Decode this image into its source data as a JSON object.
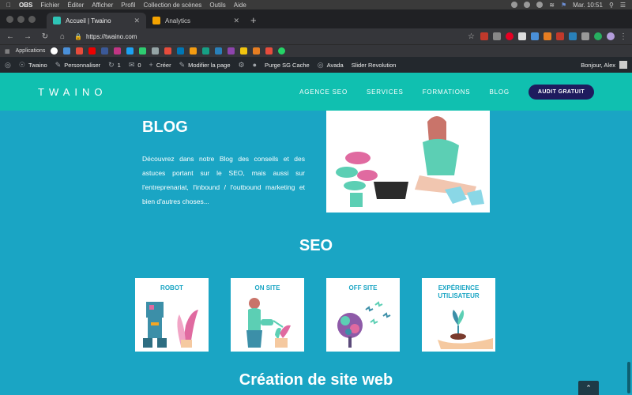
{
  "menubar": {
    "app": "OBS",
    "items": [
      "Fichier",
      "Éditer",
      "Afficher",
      "Profil",
      "Collection de scènes",
      "Outils",
      "Aide"
    ],
    "clock": "Mar. 10:51"
  },
  "tabs": [
    {
      "title": "Accueil | Twaino",
      "color": "#2ec4b6"
    },
    {
      "title": "Analytics",
      "color": "#f4a300"
    }
  ],
  "address": {
    "url": "https://twaino.com"
  },
  "bookmarks": {
    "apps_label": "Applications"
  },
  "wpbar": {
    "site": "Twaino",
    "customize": "Personnaliser",
    "updates": "1",
    "comments": "0",
    "new": "Créer",
    "edit": "Modifier la page",
    "purge": "Purge SG Cache",
    "avada": "Avada",
    "slider": "Slider Revolution",
    "greeting": "Bonjour, Alex"
  },
  "site": {
    "logo": "TWAINO",
    "nav": [
      "AGENCE SEO",
      "SERVICES",
      "FORMATIONS",
      "BLOG"
    ],
    "cta": "AUDIT GRATUIT"
  },
  "blog": {
    "title": "BLOG",
    "text": "Découvrez dans notre Blog des conseils et des astuces portant sur le SEO, mais aussi sur l'entreprenariat, l'inbound / l'outbound marketing et bien d'autres choses..."
  },
  "seo": {
    "title": "SEO",
    "cards": [
      {
        "label": "ROBOT"
      },
      {
        "label": "ON SITE"
      },
      {
        "label": "OFF SITE"
      },
      {
        "label": "EXPÉRIENCE UTILISATEUR"
      }
    ]
  },
  "creation": {
    "title": "Création de site web"
  },
  "colors": {
    "header": "#10c0b0",
    "body": "#1aa5c4",
    "cta": "#1e1b5e"
  }
}
